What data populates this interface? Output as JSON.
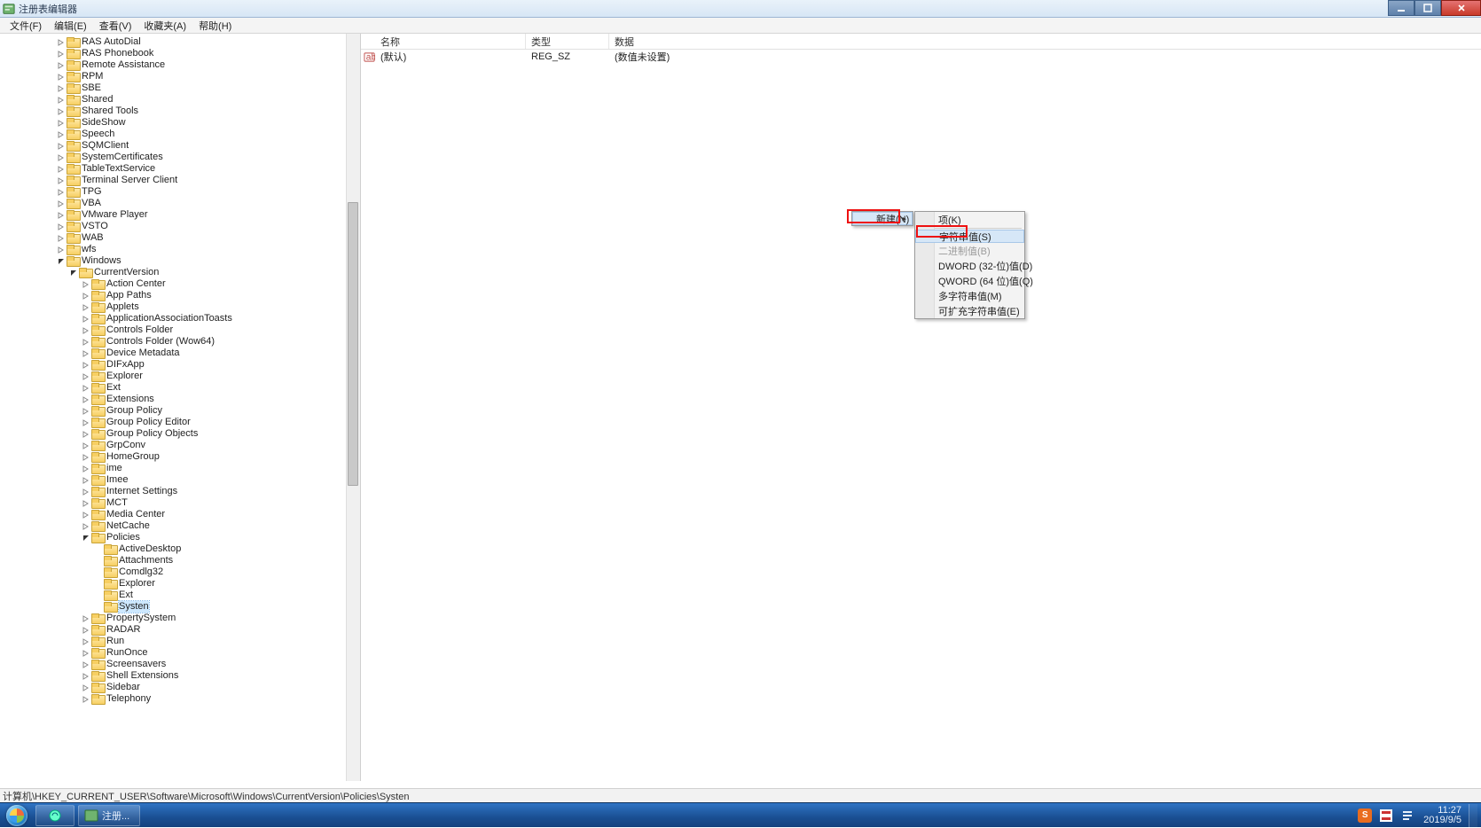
{
  "window": {
    "title": "注册表编辑器"
  },
  "menu": {
    "file": "文件(F)",
    "edit": "编辑(E)",
    "view": "查看(V)",
    "favorites": "收藏夹(A)",
    "help": "帮助(H)"
  },
  "tree": {
    "levelA": [
      "RAS AutoDial",
      "RAS Phonebook",
      "Remote Assistance",
      "RPM",
      "SBE",
      "Shared",
      "Shared Tools",
      "SideShow",
      "Speech",
      "SQMClient",
      "SystemCertificates",
      "TableTextService",
      "Terminal Server Client",
      "TPG",
      "VBA",
      "VMware Player",
      "VSTO",
      "WAB",
      "wfs"
    ],
    "windows": "Windows",
    "currentVersion": "CurrentVersion",
    "levelC_before": [
      "Action Center",
      "App Paths",
      "Applets",
      "ApplicationAssociationToasts",
      "Controls Folder",
      "Controls Folder (Wow64)",
      "Device Metadata",
      "DIFxApp",
      "Explorer",
      "Ext",
      "Extensions",
      "Group Policy",
      "Group Policy Editor",
      "Group Policy Objects",
      "GrpConv",
      "HomeGroup",
      "ime",
      "Imee",
      "Internet Settings",
      "MCT",
      "Media Center",
      "NetCache"
    ],
    "policies": "Policies",
    "levelD": [
      "ActiveDesktop",
      "Attachments",
      "Comdlg32",
      "Explorer",
      "Ext",
      "Systen"
    ],
    "levelC_after": [
      "PropertySystem",
      "RADAR",
      "Run",
      "RunOnce",
      "Screensavers",
      "Shell Extensions",
      "Sidebar",
      "Telephony"
    ]
  },
  "list": {
    "headers": {
      "name": "名称",
      "type": "类型",
      "data": "数据"
    },
    "row": {
      "name": "(默认)",
      "type": "REG_SZ",
      "data": "(数值未设置)"
    }
  },
  "ctx": {
    "new": "新建(N)",
    "sub": {
      "key": "项(K)",
      "string": "字符串值(S)",
      "binary": "二进制值(B)",
      "dword": "DWORD (32-位)值(D)",
      "qword": "QWORD (64 位)值(Q)",
      "multi": "多字符串值(M)",
      "expand": "可扩充字符串值(E)"
    }
  },
  "status": {
    "path": "计算机\\HKEY_CURRENT_USER\\Software\\Microsoft\\Windows\\CurrentVersion\\Policies\\Systen"
  },
  "taskbar": {
    "app": "注册...",
    "ime": "S",
    "clock_time": "11:27",
    "clock_date": "2019/9/5"
  }
}
